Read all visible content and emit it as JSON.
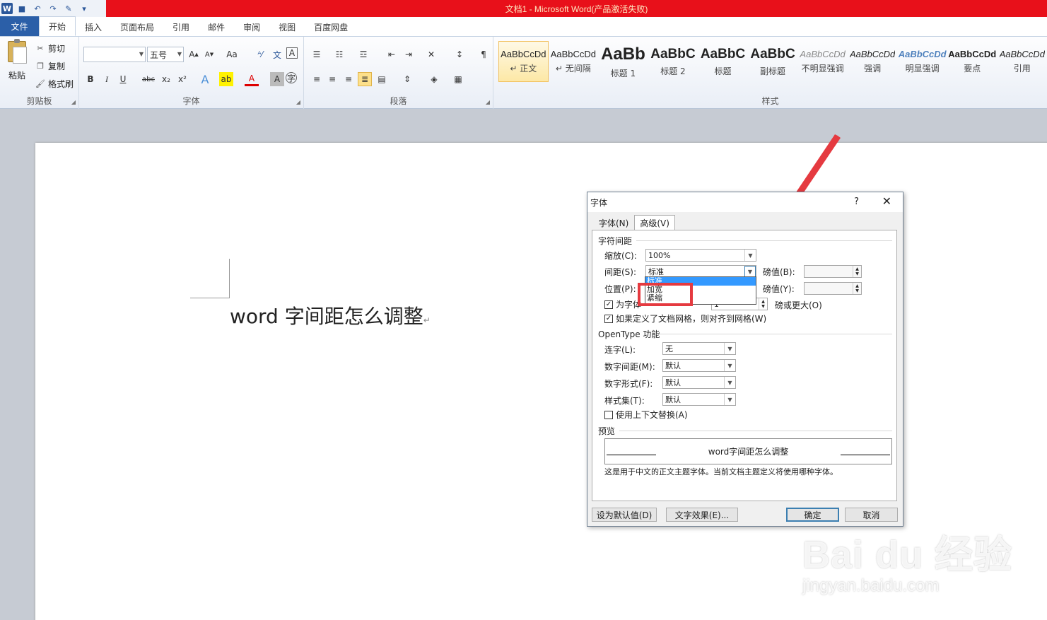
{
  "window": {
    "title": "文档1 - Microsoft Word(产品激活失败)"
  },
  "ribbon": {
    "tabs": [
      "文件",
      "开始",
      "插入",
      "页面布局",
      "引用",
      "邮件",
      "审阅",
      "视图",
      "百度网盘"
    ],
    "clipboard": {
      "paste": "粘贴",
      "cut": "剪切",
      "copy": "复制",
      "format_painter": "格式刷",
      "group_label": "剪贴板"
    },
    "font": {
      "font_name": "",
      "font_size": "五号",
      "group_label": "字体"
    },
    "paragraph": {
      "group_label": "段落"
    },
    "styles": {
      "group_label": "样式",
      "items": [
        {
          "sample": "AaBbCcDd",
          "name": "↵ 正文"
        },
        {
          "sample": "AaBbCcDd",
          "name": "↵ 无间隔"
        },
        {
          "sample": "AaBb",
          "name": "标题 1"
        },
        {
          "sample": "AaBbC",
          "name": "标题 2"
        },
        {
          "sample": "AaBbC",
          "name": "标题"
        },
        {
          "sample": "AaBbC",
          "name": "副标题"
        },
        {
          "sample": "AaBbCcDd",
          "name": "不明显强调"
        },
        {
          "sample": "AaBbCcDd",
          "name": "强调"
        },
        {
          "sample": "AaBbCcDd",
          "name": "明显强调"
        },
        {
          "sample": "AaBbCcDd",
          "name": "要点"
        },
        {
          "sample": "AaBbCcDd",
          "name": "引用"
        }
      ]
    }
  },
  "document": {
    "text": "word 字间距怎么调整"
  },
  "dialog": {
    "title": "字体",
    "help": "?",
    "close": "✕",
    "tabs": [
      "字体(N)",
      "高级(V)"
    ],
    "spacing_section": "字符间距",
    "scale_label": "缩放(C):",
    "scale_value": "100%",
    "spacing_label": "间距(S):",
    "spacing_value": "标准",
    "points_b_label": "磅值(B):",
    "position_label": "位置(P):",
    "points_y_label": "磅值(Y):",
    "kerning_label": "为字体",
    "kerning_value": "1",
    "kerning_suffix": "磅或更大(O)",
    "grid_label": "如果定义了文档网格，则对齐到网格(W)",
    "dropdown_options": [
      "标准",
      "加宽",
      "紧缩"
    ],
    "opentype_section": "OpenType 功能",
    "ligatures_label": "连字(L):",
    "ligatures_value": "无",
    "numspacing_label": "数字间距(M):",
    "numspacing_value": "默认",
    "numforms_label": "数字形式(F):",
    "numforms_value": "默认",
    "stylesets_label": "样式集(T):",
    "stylesets_value": "默认",
    "contextual_label": "使用上下文替换(A)",
    "preview_section": "预览",
    "preview_text": "word字间距怎么调整",
    "preview_note": "这是用于中文的正文主题字体。当前文档主题定义将使用哪种字体。",
    "set_default_btn": "设为默认值(D)",
    "text_effects_btn": "文字效果(E)...",
    "ok_btn": "确定",
    "cancel_btn": "取消"
  },
  "watermark": {
    "main": "Bai du 经验",
    "sub": "jingyan.baidu.com"
  }
}
